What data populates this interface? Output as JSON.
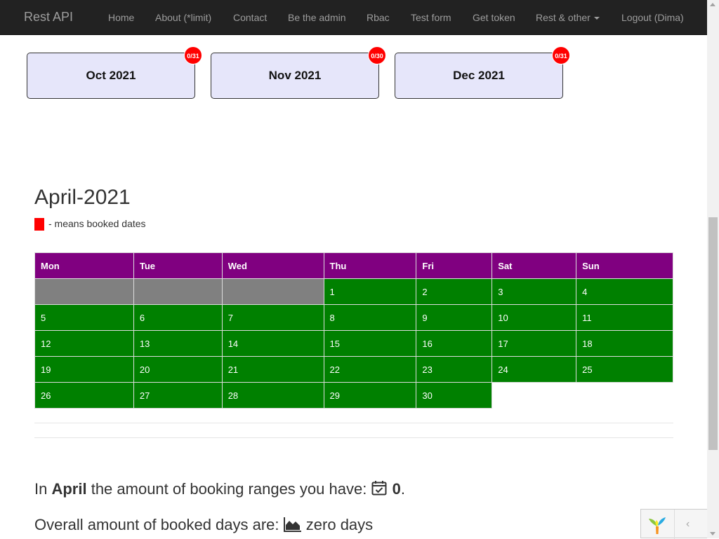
{
  "navbar": {
    "brand": "Rest API",
    "items": [
      {
        "label": "Home"
      },
      {
        "label": "About (*limit)"
      },
      {
        "label": "Contact"
      },
      {
        "label": "Be the admin"
      },
      {
        "label": "Rbac"
      },
      {
        "label": "Test form"
      },
      {
        "label": "Get token"
      },
      {
        "label": "Rest & other"
      },
      {
        "label": "Logout (Dima)"
      }
    ]
  },
  "months": [
    {
      "label": "Oct 2021",
      "badge": "0/31"
    },
    {
      "label": "Nov 2021",
      "badge": "0/30"
    },
    {
      "label": "Dec 2021",
      "badge": "0/31"
    }
  ],
  "calendar": {
    "title": "April-2021",
    "legend": "- means booked dates",
    "headers": [
      "Mon",
      "Tue",
      "Wed",
      "Thu",
      "Fri",
      "Sat",
      "Sun"
    ],
    "weeks": [
      [
        "",
        "",
        "",
        "1",
        "2",
        "3",
        "4"
      ],
      [
        "5",
        "6",
        "7",
        "8",
        "9",
        "10",
        "11"
      ],
      [
        "12",
        "13",
        "14",
        "15",
        "16",
        "17",
        "18"
      ],
      [
        "19",
        "20",
        "21",
        "22",
        "23",
        "24",
        "25"
      ],
      [
        "26",
        "27",
        "28",
        "29",
        "30",
        "",
        ""
      ]
    ]
  },
  "stats": {
    "line1_prefix": "In ",
    "month": "April",
    "line1_mid": " the amount of booking ranges you have: ",
    "ranges_count": "0",
    "line1_suffix": ".",
    "line2_prefix": "Overall amount of booked days are: ",
    "days_text": "zero days"
  },
  "colors": {
    "header_bg": "#800080",
    "available_bg": "#008000",
    "blank_bg": "#808080",
    "booked_bg": "#ff0000",
    "card_bg": "#e6e6fa"
  },
  "icons": {
    "stat1": "calendar-check-icon",
    "stat2": "area-chart-icon",
    "toolbar": "yii-logo-icon"
  }
}
